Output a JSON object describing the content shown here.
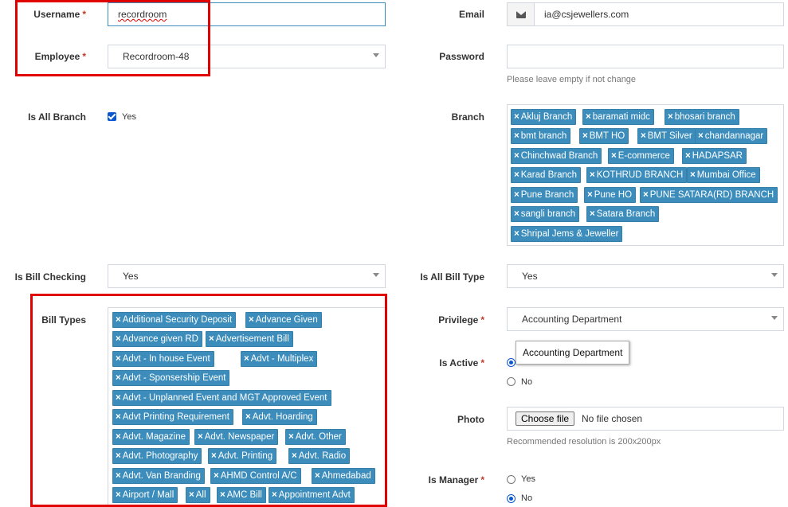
{
  "colors": {
    "accent": "#3c8dbc",
    "required": "#c0392b",
    "highlight": "#e00000"
  },
  "username": {
    "label": "Username",
    "required": "*",
    "value": "recordroom"
  },
  "employee": {
    "label": "Employee",
    "required": "*",
    "value": "Recordroom-48"
  },
  "email": {
    "label": "Email",
    "value": "ia@csjewellers.com",
    "icon": "envelope-icon"
  },
  "password": {
    "label": "Password",
    "value": "",
    "help": "Please leave empty if not change"
  },
  "is_all_branch": {
    "label": "Is All Branch",
    "option": "Yes",
    "checked": true
  },
  "branch": {
    "label": "Branch",
    "items": [
      "Akluj Branch",
      "baramati midc",
      "bhosari branch",
      "bmt branch",
      "BMT HO",
      "BMT Silver",
      "chandannagar",
      "Chinchwad Branch",
      "E-commerce",
      "HADAPSAR",
      "Karad Branch",
      "KOTHRUD BRANCH",
      "Mumbai Office",
      "Pune Branch",
      "Pune HO",
      "PUNE SATARA(RD) BRANCH",
      "sangli branch",
      "Satara Branch",
      "Shripal Jems & Jeweller"
    ]
  },
  "is_bill_checking": {
    "label": "Is Bill Checking",
    "value": "Yes"
  },
  "is_all_bill_type": {
    "label": "Is All Bill Type",
    "value": "Yes"
  },
  "bill_types": {
    "label": "Bill Types",
    "items": [
      "Additional Security Deposit",
      "Advance Given",
      "Advance given RD",
      "Advertisement Bill",
      "Advt - In house Event",
      "Advt - Multiplex",
      "Advt - Sponsership Event",
      "Advt - Unplanned Event and MGT Approved Event",
      "Advt Printing Requirement",
      "Advt. Hoarding",
      "Advt. Magazine",
      "Advt. Newspaper",
      "Advt. Other",
      "Advt. Photography",
      "Advt. Printing",
      "Advt. Radio",
      "Advt. Van Branding",
      "AHMD Control A/C",
      "Ahmedabad",
      "Airport / Mall",
      "All",
      "AMC Bill",
      "Appointment Advt"
    ]
  },
  "privilege": {
    "label": "Privilege",
    "required": "*",
    "value": "Accounting Department",
    "tooltip": "Accounting Department"
  },
  "is_active": {
    "label": "Is Active",
    "required": "*",
    "options": [
      "Yes",
      "No"
    ],
    "selected": "Yes"
  },
  "photo": {
    "label": "Photo",
    "button": "Choose file",
    "status": "No file chosen",
    "help": "Recommended resolution is 200x200px"
  },
  "is_manager": {
    "label": "Is Manager",
    "required": "*",
    "options": [
      "Yes",
      "No"
    ],
    "selected": "No"
  }
}
